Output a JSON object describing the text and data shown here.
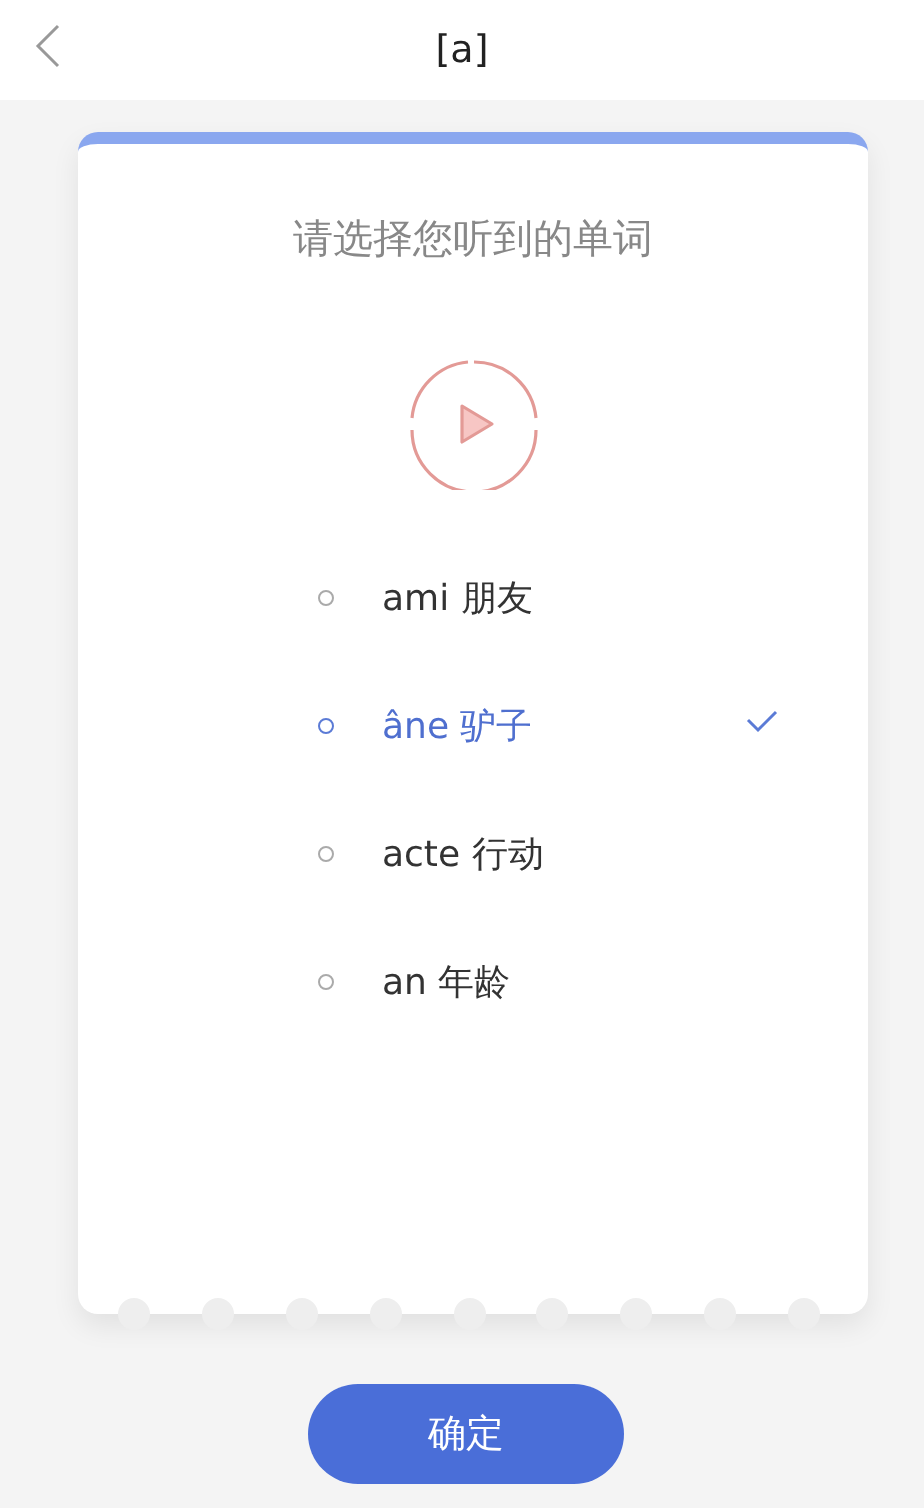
{
  "header": {
    "title": "[a]"
  },
  "card": {
    "prompt": "请选择您听到的单词",
    "options": [
      {
        "text": "ami 朋友",
        "selected": false
      },
      {
        "text": "âne 驴子",
        "selected": true
      },
      {
        "text": "acte 行动",
        "selected": false
      },
      {
        "text": "an 年龄",
        "selected": false
      }
    ]
  },
  "confirm_button": "确定"
}
